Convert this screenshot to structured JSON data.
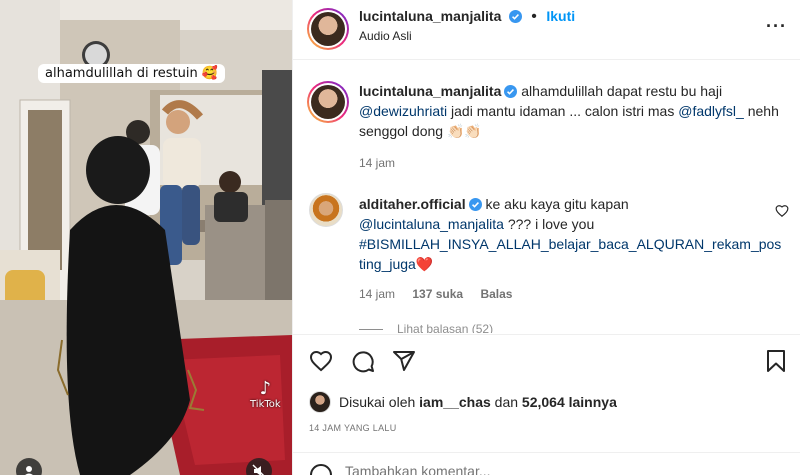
{
  "media": {
    "overlay_text": "alhamdulillah di restuin 🥰",
    "watermark": "TikTok"
  },
  "post": {
    "author": "lucintaluna_manjalita",
    "separator": "•",
    "follow_label": "Ikuti",
    "audio_label": "Audio Asli",
    "more_label": "···"
  },
  "caption": {
    "author": "lucintaluna_manjalita",
    "text_1": "alhamdulillah dapat restu bu haji",
    "mention_1": "@dewizuhriati",
    "text_2": "jadi mantu idaman ... calon istri mas",
    "mention_2": "@fadlyfsl_",
    "text_3": "nehh senggol dong 👏🏻👏🏻",
    "time": "14 jam"
  },
  "comment": {
    "author": "alditaher.official",
    "text_1": "ke aku kaya gitu kapan",
    "mention": "@lucintaluna_manjalita",
    "text_2": "??? i love you",
    "hashtag_line_1": "#BISMILLAH_INSYA_ALLAH_belajar_baca_ALQURAN_rekam_pos",
    "hashtag_line_2": "ting_juga",
    "hashtag_tail": "❤️",
    "time": "14 jam",
    "likes": "137 suka",
    "reply_label": "Balas",
    "view_replies": "Lihat balasan (52)"
  },
  "likes_bar": {
    "prefix": "Disukai oleh",
    "user": "iam__chas",
    "connector": "dan",
    "count": "52,064 lainnya"
  },
  "timestamp": "14 JAM YANG LALU",
  "add_comment": {
    "placeholder": "Tambahkan komentar..."
  },
  "colors": {
    "accent": "#0095f6",
    "link": "#00376b",
    "muted": "#737373",
    "divider": "#efefef",
    "verified": "#3897f0"
  }
}
